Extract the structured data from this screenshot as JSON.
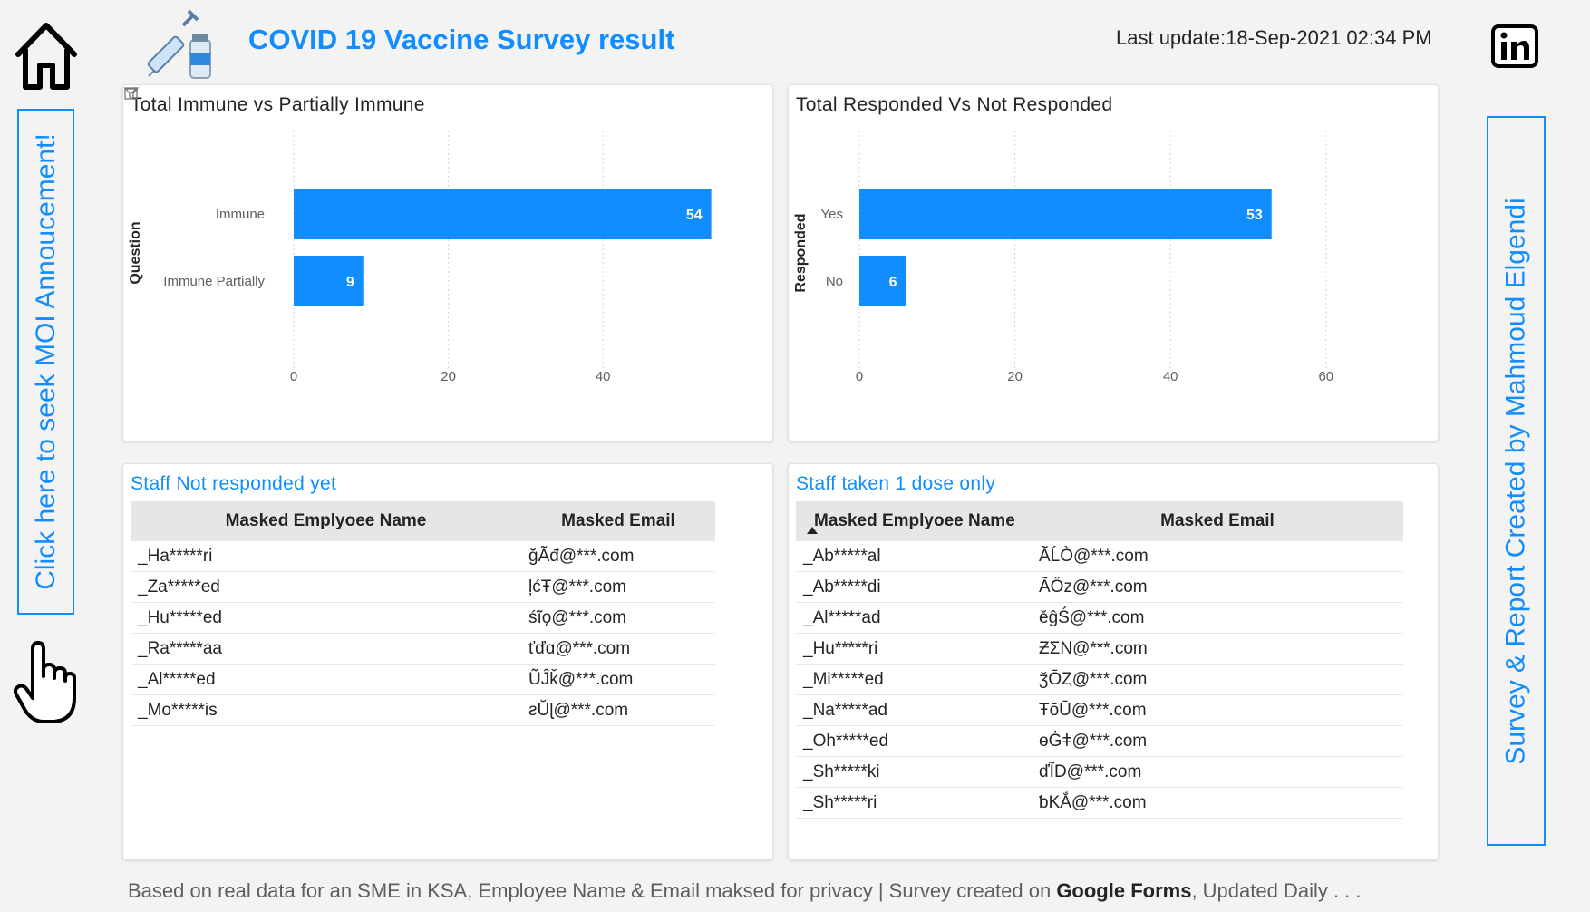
{
  "header": {
    "title": "COVID 19 Vaccine Survey result",
    "last_update": "Last update:18-Sep-2021 02:34 PM"
  },
  "nav": {
    "left_button_label": "Click here to seek MOI Annoucement!",
    "right_button_label": "Survey & Report Created by Mahmoud Elgendi",
    "home_icon": "house-icon",
    "linkedin_icon": "linkedin-icon",
    "hand_icon": "pointing-hand-icon"
  },
  "chart1_title": "Total Immune vs Partially Immune",
  "chart2_title": "Total Responded Vs Not Responded",
  "chart_data": [
    {
      "type": "bar",
      "orientation": "horizontal",
      "title": "Total Immune vs Partially Immune",
      "ylabel": "Question",
      "xlabel": "",
      "categories": [
        "Immune",
        "Immune Partially"
      ],
      "values": [
        54,
        9
      ],
      "xlim": [
        0,
        50
      ],
      "x_ticks": [
        0,
        20,
        40
      ],
      "grid": true,
      "color": "#118dff"
    },
    {
      "type": "bar",
      "orientation": "horizontal",
      "title": "Total Responded Vs Not Responded",
      "ylabel": "Responded",
      "xlabel": "",
      "categories": [
        "Yes",
        "No"
      ],
      "values": [
        53,
        6
      ],
      "xlim": [
        0,
        60
      ],
      "x_ticks": [
        0,
        20,
        40,
        60
      ],
      "grid": true,
      "color": "#118dff"
    }
  ],
  "table1": {
    "title": "Staff Not responded yet",
    "columns": [
      "Masked Emplyoee Name",
      "Masked Email"
    ],
    "rows": [
      [
        "_Ha*****ri",
        "ğÃđ@***.com"
      ],
      [
        "_Za*****ed",
        "ļćŦ@***.com"
      ],
      [
        "_Hu*****ed",
        "śĩǫ@***.com"
      ],
      [
        "_Ra*****aa",
        "ťďɑ@***.com"
      ],
      [
        "_Al*****ed",
        "ŨĴǩ@***.com"
      ],
      [
        "_Mo*****is",
        "ƨŬɭ@***.com"
      ]
    ]
  },
  "table2": {
    "title": "Staff taken 1 dose only",
    "columns": [
      "Masked Emplyoee Name",
      "Masked Email"
    ],
    "rows": [
      [
        "_Ab*****al",
        "ÃĹÒ@***.com"
      ],
      [
        "_Ab*****di",
        "ÃŐz@***.com"
      ],
      [
        "_Al*****ad",
        "ěĝŚ@***.com"
      ],
      [
        "_Hu*****ri",
        "ƵΣN@***.com"
      ],
      [
        "_Mi*****ed",
        "ǯŌȤ@***.com"
      ],
      [
        "_Na*****ad",
        "ŦōŪ@***.com"
      ],
      [
        "_Oh*****ed",
        "ɵĠǂ@***.com"
      ],
      [
        "_Sh*****ki",
        "ďĨD@***.com"
      ],
      [
        "_Sh*****ri",
        "ƅKẮ@***.com"
      ]
    ]
  },
  "footer": {
    "prefix": "Based on real data for an SME in KSA, Employee Name & Email maksed for privacy | Survey created on ",
    "bold": "Google Forms",
    "suffix": ", Updated Daily . . ."
  }
}
